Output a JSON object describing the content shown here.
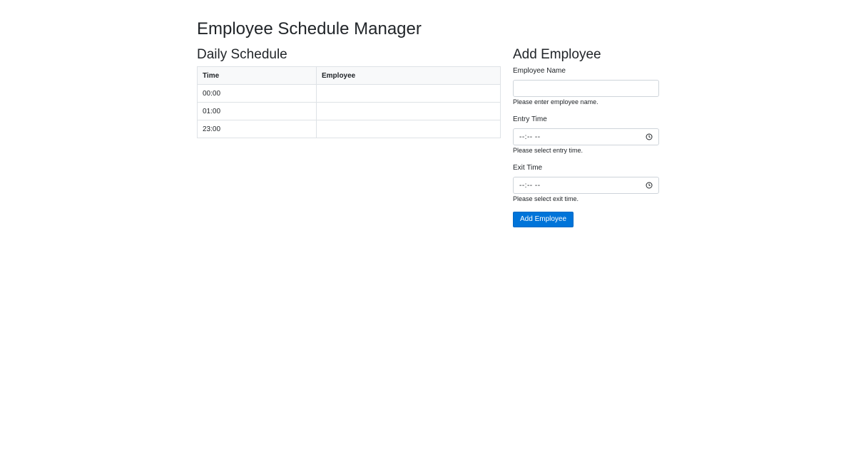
{
  "page": {
    "title": "Employee Schedule Manager"
  },
  "schedule": {
    "title": "Daily Schedule",
    "columns": [
      "Time",
      "Employee"
    ],
    "rows": [
      {
        "time": "00:00",
        "employee": ""
      },
      {
        "time": "01:00",
        "employee": ""
      },
      {
        "time": "23:00",
        "employee": ""
      }
    ]
  },
  "form": {
    "title": "Add Employee",
    "name_label": "Employee Name",
    "name_value": "",
    "name_help": "Please enter employee name.",
    "entry_label": "Entry Time",
    "entry_placeholder": "--:-- --",
    "entry_help": "Please select entry time.",
    "exit_label": "Exit Time",
    "exit_placeholder": "--:-- --",
    "exit_help": "Please select exit time.",
    "submit_label": "Add Employee"
  },
  "colors": {
    "accent": "#0074d9",
    "border": "#dee2e6",
    "header_bg": "#f8f9fa"
  },
  "icons": {
    "time_picker": "clock-icon"
  }
}
